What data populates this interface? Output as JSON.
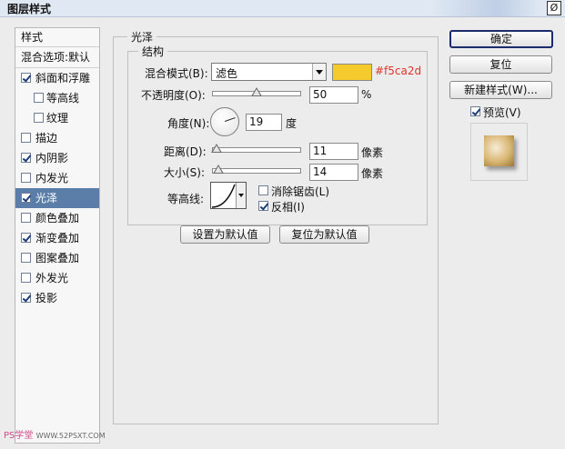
{
  "window": {
    "title": "图层样式",
    "close_label": "Ø"
  },
  "left_panel": {
    "header": "样式",
    "blend": "混合选项:默认",
    "items": [
      {
        "label": "斜面和浮雕",
        "checked": true,
        "selected": false,
        "indent": false
      },
      {
        "label": "等高线",
        "checked": false,
        "selected": false,
        "indent": true
      },
      {
        "label": "纹理",
        "checked": false,
        "selected": false,
        "indent": true
      },
      {
        "label": "描边",
        "checked": false,
        "selected": false,
        "indent": false
      },
      {
        "label": "内阴影",
        "checked": true,
        "selected": false,
        "indent": false
      },
      {
        "label": "内发光",
        "checked": false,
        "selected": false,
        "indent": false
      },
      {
        "label": "光泽",
        "checked": true,
        "selected": true,
        "indent": false
      },
      {
        "label": "颜色叠加",
        "checked": false,
        "selected": false,
        "indent": false
      },
      {
        "label": "渐变叠加",
        "checked": true,
        "selected": false,
        "indent": false
      },
      {
        "label": "图案叠加",
        "checked": false,
        "selected": false,
        "indent": false
      },
      {
        "label": "外发光",
        "checked": false,
        "selected": false,
        "indent": false
      },
      {
        "label": "投影",
        "checked": true,
        "selected": false,
        "indent": false
      }
    ]
  },
  "satin": {
    "group_title": "光泽",
    "struct_title": "结构",
    "blend_mode_label": "混合模式(B):",
    "blend_mode_value": "滤色",
    "color": "#f5ca2d",
    "color_hex_text": "#f5ca2d",
    "opacity_label": "不透明度(O):",
    "opacity_value": "50",
    "opacity_unit": "%",
    "opacity_fraction": 0.5,
    "angle_label": "角度(N):",
    "angle_value": "19",
    "angle_unit": "度",
    "distance_label": "距离(D):",
    "distance_value": "11",
    "distance_unit": "像素",
    "distance_fraction": 0.045,
    "size_label": "大小(S):",
    "size_value": "14",
    "size_unit": "像素",
    "size_fraction": 0.06,
    "contour_label": "等高线:",
    "antialias_label": "消除锯齿(L)",
    "antialias_checked": false,
    "invert_label": "反相(I)",
    "invert_checked": true,
    "set_default": "设置为默认值",
    "reset_default": "复位为默认值"
  },
  "right": {
    "ok": "确定",
    "reset": "复位",
    "new_style": "新建样式(W)...",
    "preview_label": "预览(V)",
    "preview_checked": true
  },
  "watermark": {
    "text": "PS学堂",
    "url": "WWW.52PSXT.COM"
  }
}
